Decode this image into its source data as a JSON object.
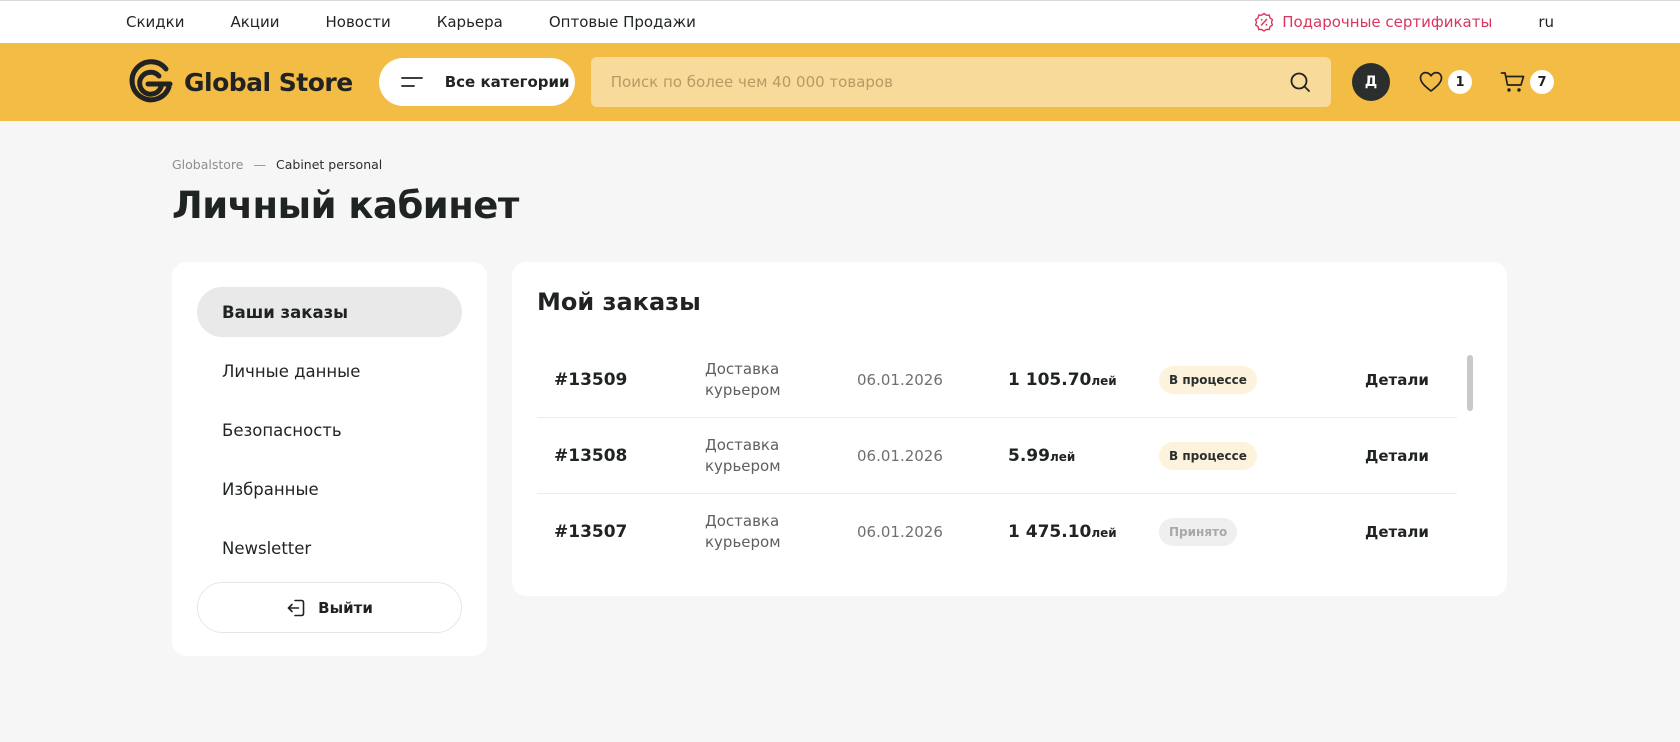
{
  "topnav": {
    "links": [
      "Скидки",
      "Акции",
      "Новости",
      "Карьера",
      "Оптовые Продажи"
    ],
    "gift_label": "Подарочные сертификаты",
    "lang": "ru"
  },
  "header": {
    "logo_text": "Global Store",
    "categories_label": "Все категории",
    "search_placeholder": "Поиск по более чем 40 000 товаров",
    "avatar_letter": "Д",
    "favorites_count": "1",
    "cart_count": "7"
  },
  "breadcrumb": {
    "home": "Globalstore",
    "separator": "—",
    "current": "Cabinet personal"
  },
  "page_title": "Личный кабинет",
  "sidebar": {
    "items": [
      "Ваши заказы",
      "Личные данные",
      "Безопасность",
      "Избранные",
      "Newsletter"
    ],
    "logout_label": "Выйти"
  },
  "orders": {
    "title": "Мой заказы",
    "rows": [
      {
        "id": "#13509",
        "ship_line1": "Доставка",
        "ship_line2": "курьером",
        "date": "06.01.2026",
        "price": "1 105.70",
        "currency": "лей",
        "status": "В процессе",
        "details": "Детали"
      },
      {
        "id": "#13508",
        "ship_line1": "Доставка",
        "ship_line2": "курьером",
        "date": "06.01.2026",
        "price": "5.99",
        "currency": "лей",
        "status": "В процессе",
        "details": "Детали"
      },
      {
        "id": "#13507",
        "ship_line1": "Доставка",
        "ship_line2": "курьером",
        "date": "06.01.2026",
        "price": "1 475.10",
        "currency": "лей",
        "status": "Принято",
        "details": "Детали"
      }
    ]
  },
  "colors": {
    "header_yellow": "#f3bc45",
    "gift_pink": "#d9355d",
    "status_processing_bg": "#fdf2dc",
    "status_accepted_bg": "#efefef"
  },
  "icons": [
    "gift-percent-icon",
    "logo-icon",
    "menu-icon",
    "search-icon",
    "heart-icon",
    "cart-icon",
    "logout-icon"
  ]
}
